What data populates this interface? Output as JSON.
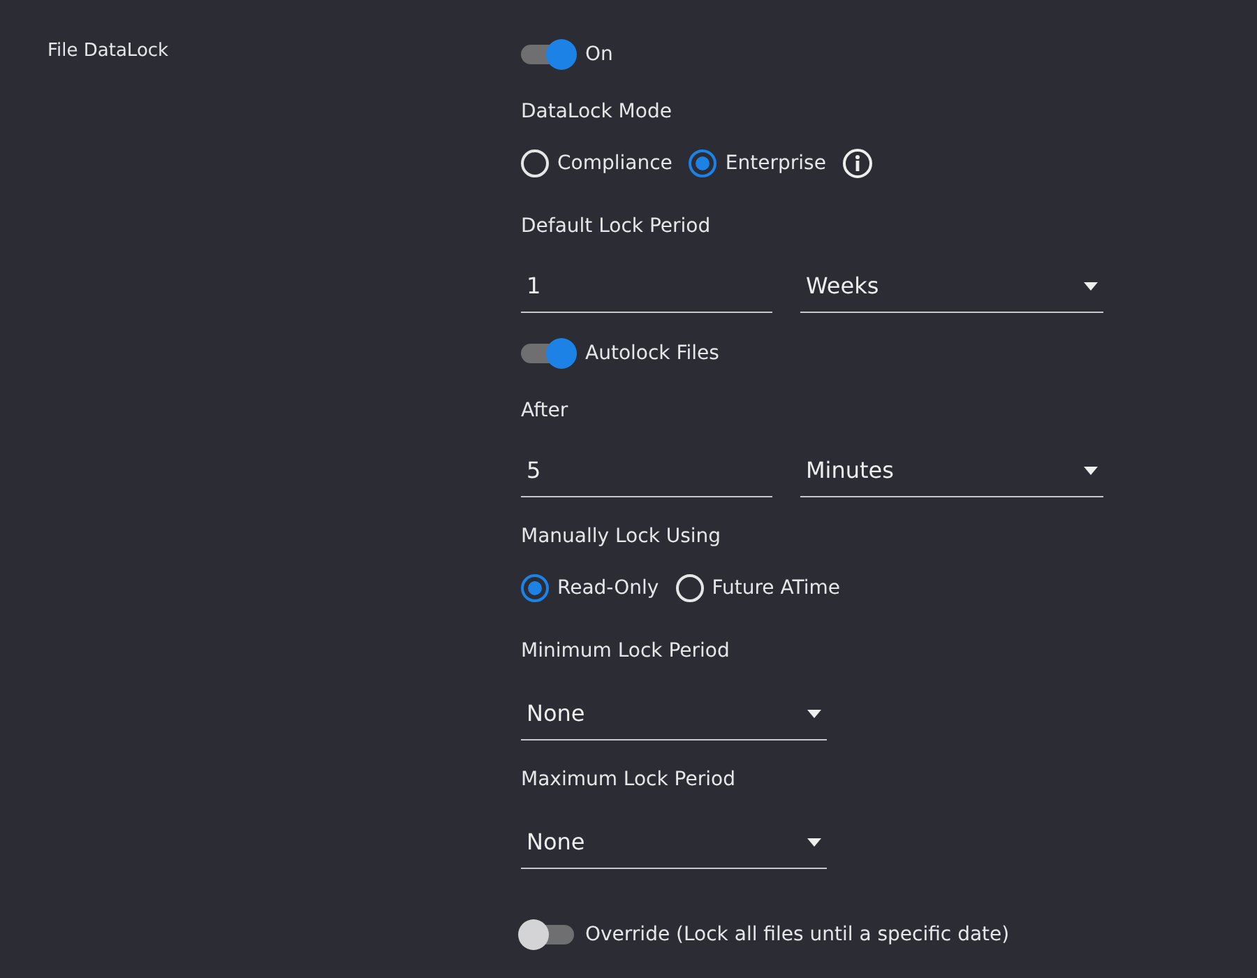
{
  "section_label": "File DataLock",
  "items": [
    {
      "kind": "toggle",
      "label": "On",
      "on": true
    },
    {
      "kind": "heading",
      "label": "DataLock Mode"
    },
    {
      "kind": "radios",
      "info": true,
      "options": [
        {
          "label": "Compliance",
          "selected": false
        },
        {
          "label": "Enterprise",
          "selected": true
        }
      ]
    },
    {
      "kind": "heading",
      "label": "Default Lock Period"
    },
    {
      "kind": "amount",
      "value": "1",
      "unit": "Weeks"
    },
    {
      "kind": "toggle",
      "label": "Autolock Files",
      "on": true
    },
    {
      "kind": "heading",
      "label": "After"
    },
    {
      "kind": "amount",
      "value": "5",
      "unit": "Minutes"
    },
    {
      "kind": "heading",
      "label": "Manually Lock Using"
    },
    {
      "kind": "radios",
      "info": false,
      "options": [
        {
          "label": "Read-Only",
          "selected": true
        },
        {
          "label": "Future ATime",
          "selected": false
        }
      ]
    },
    {
      "kind": "heading",
      "label": "Minimum Lock Period"
    },
    {
      "kind": "select",
      "value": "None"
    },
    {
      "kind": "heading",
      "label": "Maximum Lock Period"
    },
    {
      "kind": "select",
      "value": "None"
    },
    {
      "kind": "toggle",
      "label": "Override (Lock all files until a specific date)",
      "on": false
    }
  ]
}
